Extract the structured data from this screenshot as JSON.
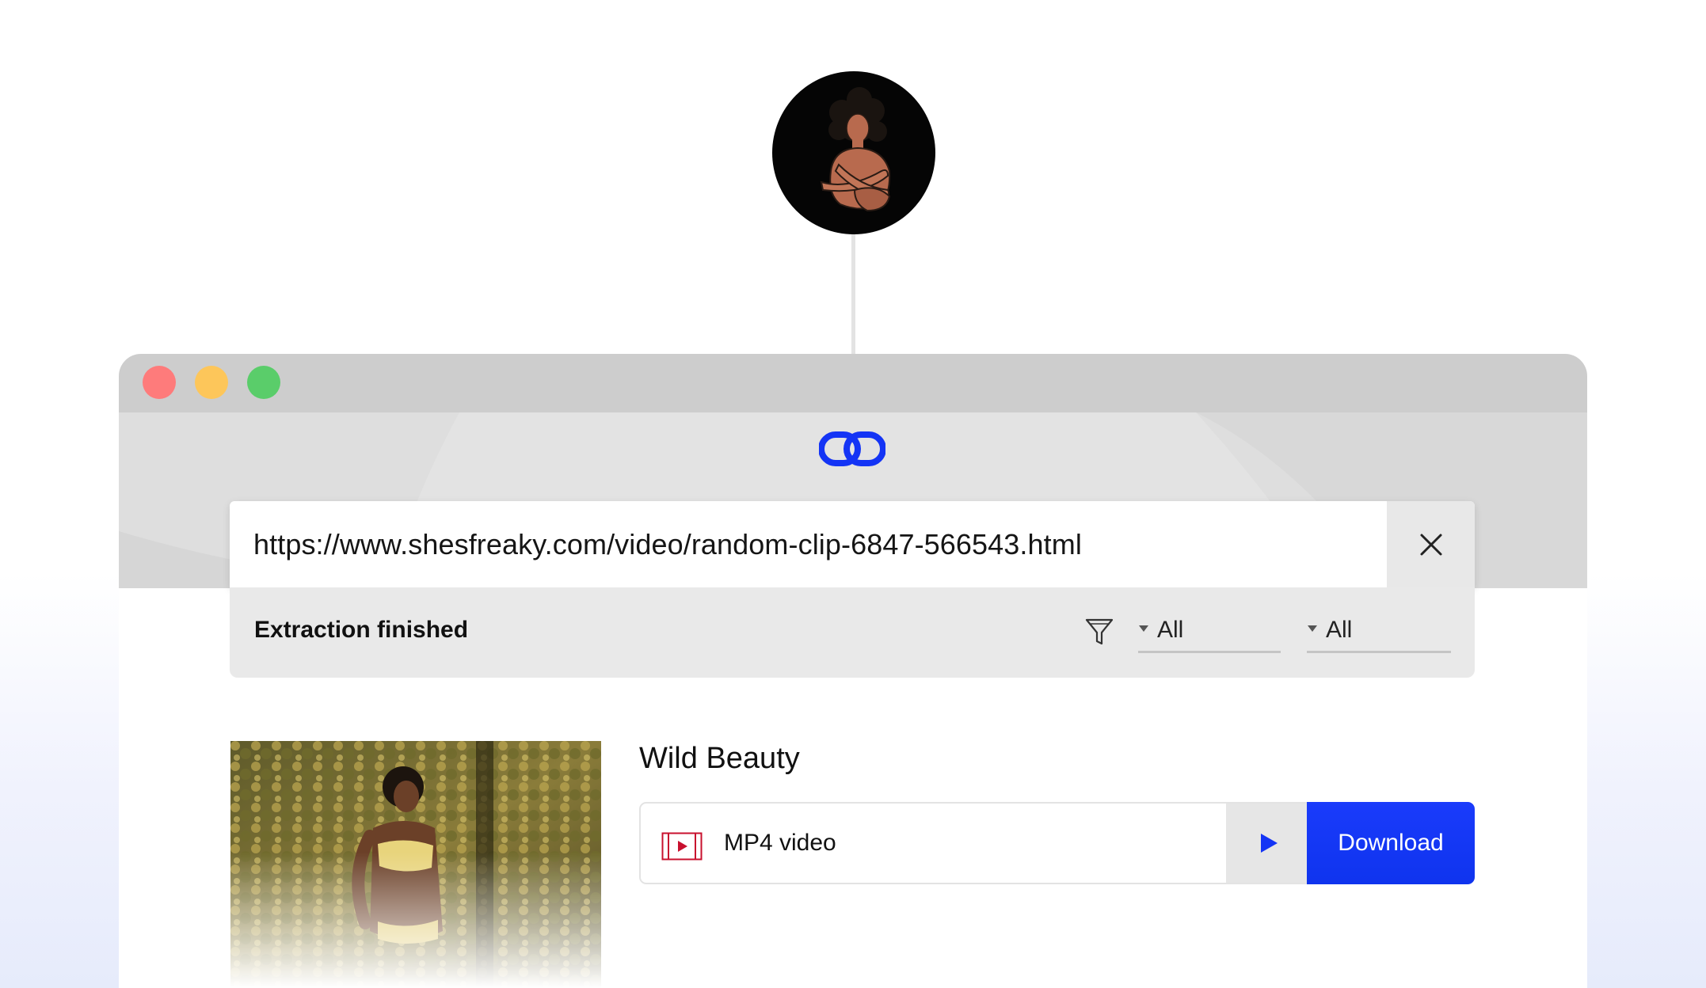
{
  "site": {
    "logo_icon": "site-avatar-illustration"
  },
  "window": {
    "controls": [
      "close",
      "minimize",
      "maximize"
    ],
    "app_logo_icon": "chain-link-icon",
    "accent_color": "#1434f5"
  },
  "url_bar": {
    "value": "https://www.shesfreaky.com/video/random-clip-6847-566543.html",
    "clear_icon": "close-icon"
  },
  "status": {
    "text": "Extraction finished",
    "filter_icon": "filter-icon",
    "select_one": "All",
    "select_two": "All"
  },
  "result": {
    "title": "Wild Beauty",
    "format_icon": "video-file-icon",
    "format_label": "MP4 video",
    "play_icon": "play-icon",
    "download_label": "Download"
  }
}
